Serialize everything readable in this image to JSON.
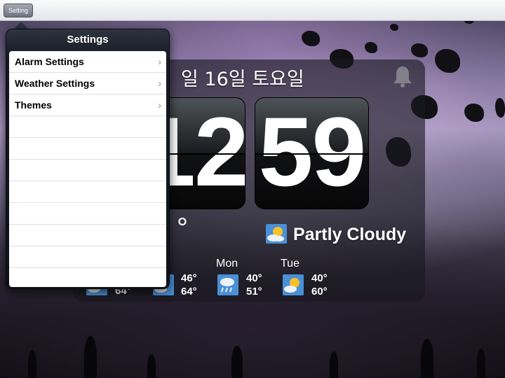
{
  "toolbar": {
    "setting_label": "Setting"
  },
  "popover": {
    "title": "Settings",
    "items": [
      {
        "label": "Alarm Settings",
        "chevron": "›"
      },
      {
        "label": "Weather Settings",
        "chevron": "›"
      },
      {
        "label": "Themes",
        "chevron": "›"
      }
    ]
  },
  "clock": {
    "date": "일 16일 토요일",
    "hours_visible": "12",
    "minutes": "59",
    "alarm_icon": "bell-icon"
  },
  "weather": {
    "current_temp": "°",
    "condition": "Partly Cloudy",
    "condition_icon": "partly-cloudy-icon",
    "forecast": [
      {
        "low": "64°",
        "icon": "partly-cloudy-icon"
      },
      {
        "high": "46°",
        "low": "64°",
        "icon": "partly-cloudy-icon"
      },
      {
        "day": "Mon",
        "high": "40°",
        "low": "51°",
        "icon": "rain-icon"
      },
      {
        "day": "Tue",
        "high": "40°",
        "low": "60°",
        "icon": "partly-cloudy-icon"
      }
    ]
  },
  "colors": {
    "accent_blue": "#4a90d6",
    "sun": "#f6c12b",
    "widget_bg": "#19191f"
  }
}
